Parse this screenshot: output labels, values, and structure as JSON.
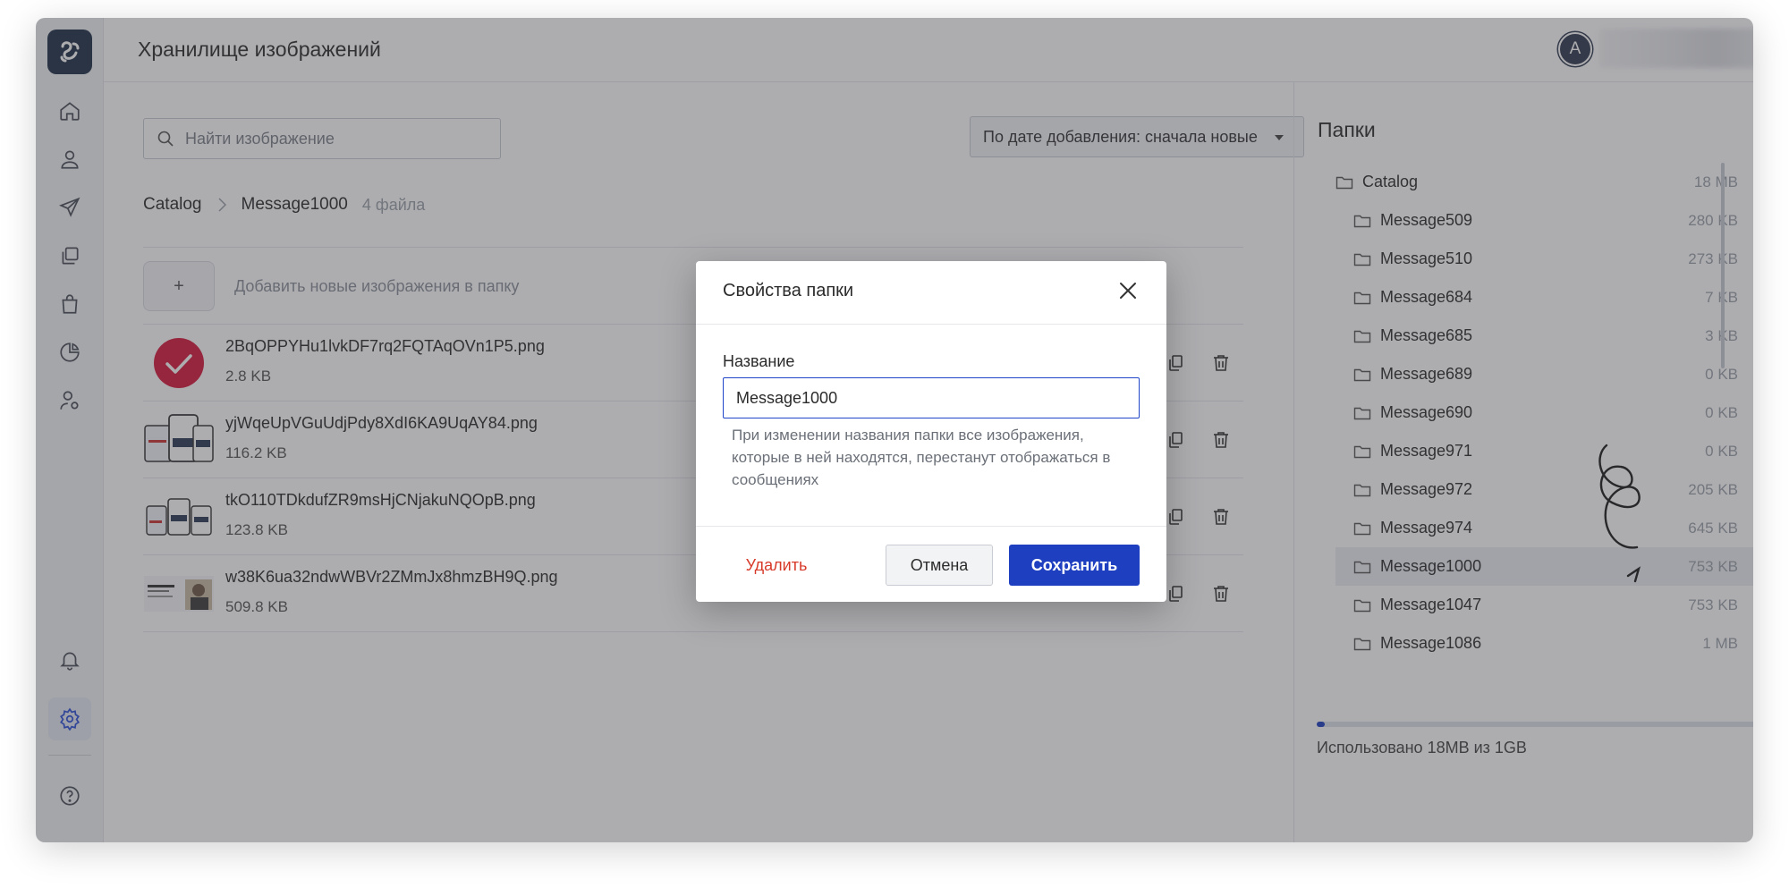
{
  "header": {
    "title": "Хранилище изображений",
    "avatar_initial": "A"
  },
  "search": {
    "placeholder": "Найти изображение",
    "value": ""
  },
  "sort": {
    "selected": "По дате добавления: сначала новые"
  },
  "breadcrumb": {
    "root": "Catalog",
    "current": "Message1000",
    "count": "4 файла"
  },
  "add": {
    "button_label": "+",
    "label": "Добавить новые изображения в папку"
  },
  "files": [
    {
      "name": "2BqOPPYHu1lvkDF7rq2FQTAqOVn1P5.png",
      "size": "2.8 KB"
    },
    {
      "name": "yjWqeUpVGuUdjPdy8XdI6KA9UqAY84.png",
      "size": "116.2 KB"
    },
    {
      "name": "tkO110TDkdufZR9msHjCNjakuNQOpB.png",
      "size": "123.8 KB"
    },
    {
      "name": "w38K6ua32ndwWBVr2ZMmJx8hmzBH9Q.png",
      "size": "509.8 KB"
    }
  ],
  "folders": {
    "title": "Папки",
    "items": [
      {
        "name": "Catalog",
        "size": "18 MB"
      },
      {
        "name": "Message509",
        "size": "280 KB"
      },
      {
        "name": "Message510",
        "size": "273 KB"
      },
      {
        "name": "Message684",
        "size": "7 KB"
      },
      {
        "name": "Message685",
        "size": "3 KB"
      },
      {
        "name": "Message689",
        "size": "0 KB"
      },
      {
        "name": "Message690",
        "size": "0 KB"
      },
      {
        "name": "Message971",
        "size": "0 KB"
      },
      {
        "name": "Message972",
        "size": "205 KB"
      },
      {
        "name": "Message974",
        "size": "645 KB"
      },
      {
        "name": "Message1000",
        "size": "753 KB"
      },
      {
        "name": "Message1047",
        "size": "753 KB"
      },
      {
        "name": "Message1086",
        "size": "1 MB"
      }
    ],
    "usage_text": "Использовано 18MB из 1GB",
    "usage_fraction": 0.018
  },
  "modal": {
    "title": "Свойства папки",
    "field_label": "Название",
    "name_value": "Message1000",
    "hint": "При изменении названия папки все изображения, которые в ней находятся, перестанут отображаться в сообщениях",
    "delete_label": "Удалить",
    "cancel_label": "Отмена",
    "save_label": "Сохранить"
  },
  "colors": {
    "accent": "#1e40c0",
    "danger": "#d83a2a",
    "logo_bg": "#1e2f45",
    "check_red": "#d8183a"
  },
  "icons": {
    "sidebar": [
      "home-icon",
      "user-icon",
      "send-icon",
      "copy-icon",
      "bag-icon",
      "pie-chart-icon",
      "user-settings-icon",
      "bell-icon",
      "settings-icon",
      "help-icon"
    ],
    "row_actions": [
      "copy-icon",
      "trash-icon"
    ]
  }
}
